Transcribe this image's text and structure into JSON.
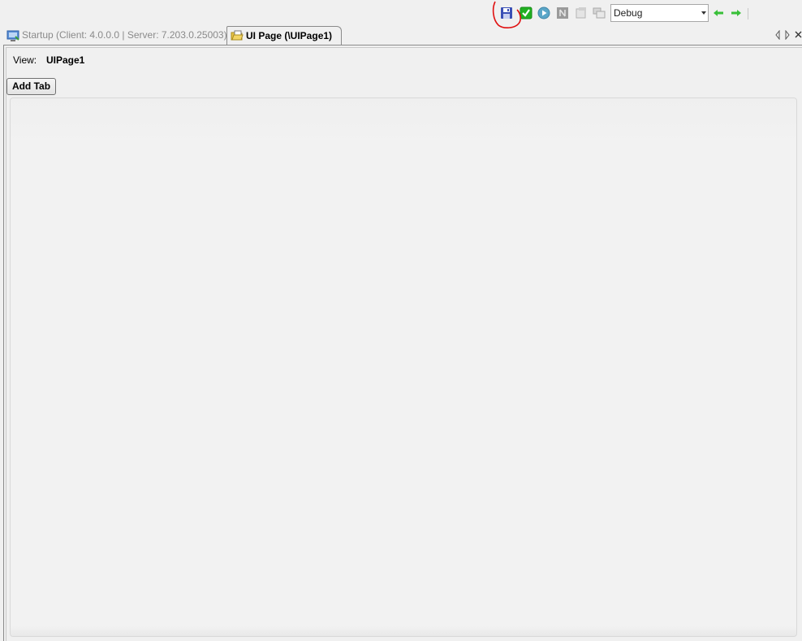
{
  "toolbar": {
    "icons": [
      "save-icon",
      "check-icon",
      "run-icon",
      "stop-icon",
      "new-window-icon",
      "cascade-windows-icon",
      "back-arrow-icon",
      "forward-arrow-icon"
    ],
    "configuration": {
      "selected": "Debug"
    },
    "colors": {
      "save": "#3a4fb5",
      "check": "#21b021",
      "run": "#5aa6c8",
      "arrows": "#38c038",
      "annotation": "#e01010"
    }
  },
  "tabs": [
    {
      "label": "Startup (Client: 4.0.0.0 | Server: 7.203.0.25003)",
      "active": false
    },
    {
      "label": "UI Page (\\UIPage1)",
      "active": true
    }
  ],
  "page": {
    "view_label": "View:",
    "view_value": "UIPage1",
    "add_tab_label": "Add Tab"
  }
}
